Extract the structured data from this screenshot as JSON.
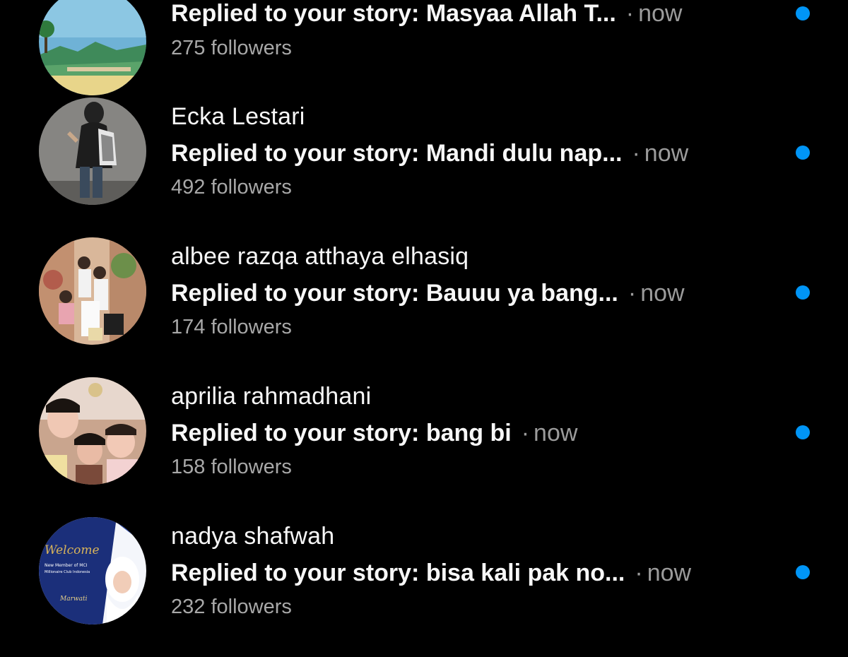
{
  "colors": {
    "background": "#000000",
    "text_primary": "#f7f7f7",
    "text_secondary": "#a8a8a8",
    "timestamp": "#9b9b9b",
    "unread_dot": "#0095f6"
  },
  "notifications": [
    {
      "name": "",
      "message": "Replied to your story: Masyaa Allah T...",
      "separator": "·",
      "time": "now",
      "followers": "275 followers",
      "unread": true,
      "avatar_icon": "landscape-avatar"
    },
    {
      "name": "Ecka Lestari",
      "message": "Replied to your story: Mandi dulu nap...",
      "separator": "·",
      "time": "now",
      "followers": "492 followers",
      "unread": true,
      "avatar_icon": "person-standing-avatar"
    },
    {
      "name": "albee razqa atthaya elhasiq",
      "message": "Replied to your story: Bauuu ya bang...",
      "separator": "·",
      "time": "now",
      "followers": "174 followers",
      "unread": true,
      "avatar_icon": "group-photo-avatar"
    },
    {
      "name": "aprilia rahmadhani",
      "message": "Replied to your story: bang bi",
      "separator": "·",
      "time": "now",
      "followers": "158 followers",
      "unread": true,
      "avatar_icon": "selfie-avatar"
    },
    {
      "name": "nadya shafwah",
      "message": "Replied to your story: bisa kali pak no...",
      "separator": "·",
      "time": "now",
      "followers": "232 followers",
      "unread": true,
      "avatar_icon": "welcome-card-avatar",
      "avatar_text": {
        "title": "Welcome",
        "line1": "New Member of MCI",
        "line2": "Millionaire Club Indonesia",
        "signature": "Marwati"
      }
    }
  ]
}
